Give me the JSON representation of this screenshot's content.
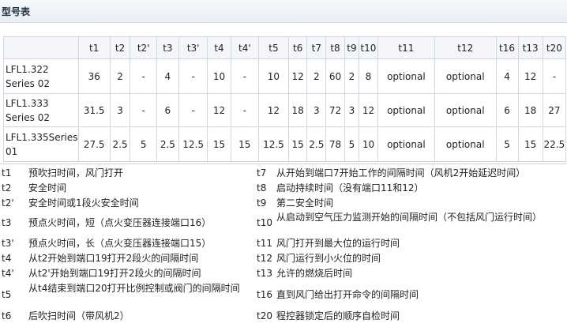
{
  "page_title": "型号表",
  "table": {
    "headers": [
      "",
      "t1",
      "t2",
      "t2'",
      "t3",
      "t3'",
      "t4",
      "t4'",
      "t5",
      "t6",
      "t7",
      "t8",
      "t9",
      "t10",
      "t11",
      "t12",
      "t16",
      "t13",
      "t20"
    ],
    "rows": [
      {
        "model_line1": "LFL1.322",
        "model_line2": "Series 02",
        "values": [
          "36",
          "2",
          "-",
          "4",
          "-",
          "10",
          "-",
          "10",
          "12",
          "2",
          "60",
          "2",
          "8",
          "optional",
          "optional",
          "4",
          "12",
          "-"
        ]
      },
      {
        "model_line1": "LFL1.333",
        "model_line2": "Series 02",
        "values": [
          "31.5",
          "3",
          "-",
          "6",
          "-",
          "12",
          "-",
          "12",
          "18",
          "3",
          "72",
          "3",
          "12",
          "optional",
          "optional",
          "6",
          "18",
          "27"
        ]
      },
      {
        "model_line1": "LFL1.335Series",
        "model_line2": "01",
        "values": [
          "27.5",
          "2.5",
          "5",
          "2.5",
          "12.5",
          "15",
          "15",
          "12.5",
          "15",
          "2.5",
          "78",
          "5",
          "10",
          "optional",
          "optional",
          "5",
          "15",
          "22.5"
        ]
      }
    ]
  },
  "legend": {
    "left": [
      {
        "code": "t1",
        "desc": "预吹扫时间，风门打开"
      },
      {
        "code": "t2",
        "desc": "安全时间"
      },
      {
        "code": "t2'",
        "desc": "安全时间或1段火安全时间"
      },
      {
        "code": "t3",
        "desc": "预点火时间，短（点火变压器连接端口16）"
      },
      {
        "code": "t3'",
        "desc": "预点火时间，长（点火变压器连接端口15）"
      },
      {
        "code": "t4",
        "desc": "从t2开始到端口19打开2段火的间隔时间"
      },
      {
        "code": "t4'",
        "desc": "从t2'开始到端口19打开2段火的间隔时间"
      },
      {
        "code": "t5",
        "desc": "从t4结束到端口20打开比例控制或阀门的间隔时间"
      },
      {
        "code": "t6",
        "desc": "后吹扫时间（带风机2）"
      }
    ],
    "right": [
      {
        "code": "t7",
        "desc": "从开始到端口7开始工作的间隔时间（风机2开始延迟时间）"
      },
      {
        "code": "t8",
        "desc": "启动持续时间（没有端口11和12）"
      },
      {
        "code": "t9",
        "desc": "第二安全时间"
      },
      {
        "code": "t10",
        "desc": "从启动到空气压力监测开始的间隔时间（不包括风门运行时间）"
      },
      {
        "code": "t11",
        "desc": "风门打开到最大位的运行时间"
      },
      {
        "code": "t12",
        "desc": "风门运行到小火位的时间"
      },
      {
        "code": "t13",
        "desc": "允许的燃烧后时间"
      },
      {
        "code": "t16",
        "desc": "直到风门给出打开命令的间隔时间"
      },
      {
        "code": "t20",
        "desc": "程控器锁定后的顺序自检时间"
      }
    ]
  }
}
